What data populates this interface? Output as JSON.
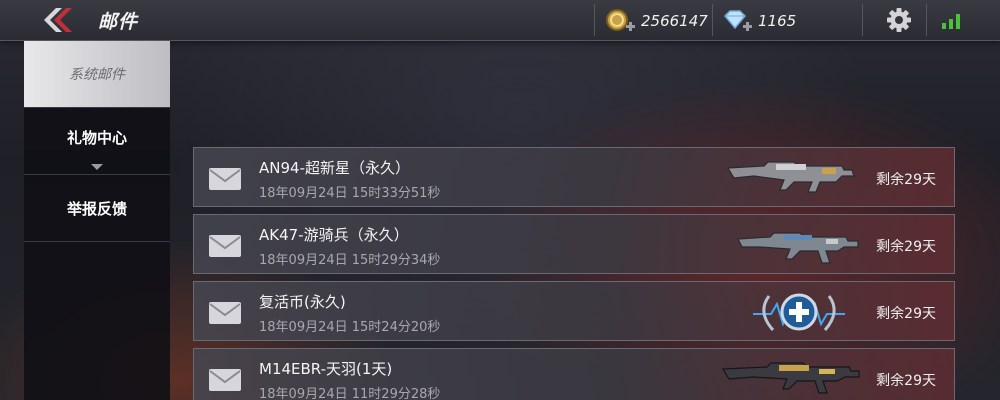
{
  "header": {
    "title": "邮件",
    "coins": "2566147",
    "diamonds": "1165",
    "icons": [
      "back-icon",
      "coin-icon",
      "diamond-icon",
      "gear-icon",
      "signal-icon"
    ]
  },
  "sidebar": {
    "items": [
      {
        "label": "系统邮件",
        "active": true
      },
      {
        "label": "礼物中心",
        "active": false
      },
      {
        "label": "举报反馈",
        "active": false
      }
    ]
  },
  "mails": [
    {
      "name": "AN94-超新星（永久）",
      "time": "18年09月24日 15时33分51秒",
      "remaining": "剩余29天",
      "item": "rifle"
    },
    {
      "name": "AK47-游骑兵（永久）",
      "time": "18年09月24日 15时29分34秒",
      "remaining": "剩余29天",
      "item": "rifle"
    },
    {
      "name": "复活币(永久)",
      "time": "18年09月24日 15时24分20秒",
      "remaining": "剩余29天",
      "item": "revive-coin"
    },
    {
      "name": "M14EBR-天羽(1天)",
      "time": "18年09月24日 11时29分28秒",
      "remaining": "剩余29天",
      "item": "rifle"
    }
  ],
  "colors": {
    "accent_red": "#c0303a",
    "signal_green": "#49c23a",
    "revive_blue": "#3fa9f5"
  }
}
